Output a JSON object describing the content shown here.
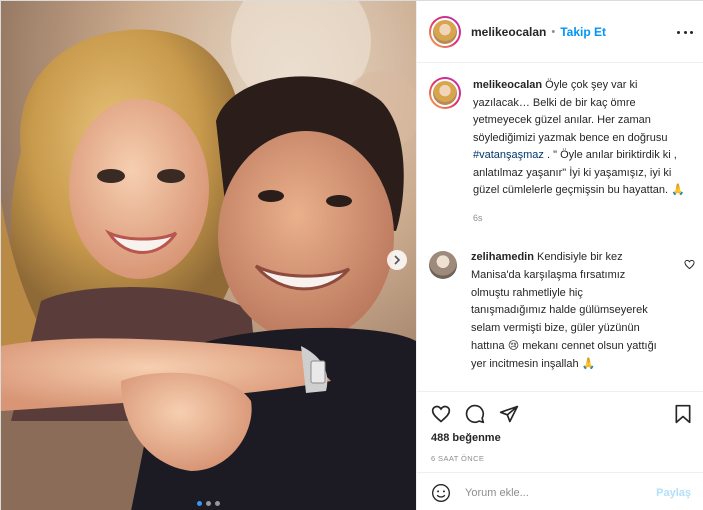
{
  "header": {
    "username": "melikeocalan",
    "separator": "•",
    "follow_label": "Takip Et"
  },
  "caption": {
    "username": "melikeocalan",
    "text_before": " Öyle çok şey var ki yazılacak… Belki de bir kaç ömre yetmeyecek güzel anılar. Her zaman söylediğimizi yazmak bence en doğrusu ",
    "hashtag": "#vatanşaşmaz",
    "text_after": " . \" Öyle anılar biriktirdik ki , anlatılmaz yaşanır\" İyi ki yaşamışız, iyi ki güzel cümlelerle geçmişsin bu hayattan. 🙏",
    "time": "6s"
  },
  "comment": {
    "username": "zelihamedin",
    "text": " Kendisiyle bir kez Manisa'da karşılaşma fırsatımız olmuştu rahmetliyle hiç tanışmadığımız halde gülümseyerek selam vermişti bize, güler yüzünün hattına 😢 mekanı cennet olsun yattığı yer incitmesin inşallah 🙏"
  },
  "actions": {
    "likes": "488 beğenme",
    "timestamp": "6 SAAT ÖNCE"
  },
  "comment_box": {
    "placeholder": "Yorum ekle...",
    "post_label": "Paylaş"
  },
  "carousel": {
    "current_slide": 1,
    "total_slides": 3
  },
  "colors": {
    "link_blue": "#0095f6",
    "hashtag": "#00376b",
    "muted": "#8e8e8e",
    "post_disabled": "#b2dffc"
  },
  "icons": [
    "chevron-right-icon",
    "more-icon",
    "heart-icon",
    "comment-icon",
    "share-icon",
    "bookmark-icon",
    "emoji-icon"
  ]
}
